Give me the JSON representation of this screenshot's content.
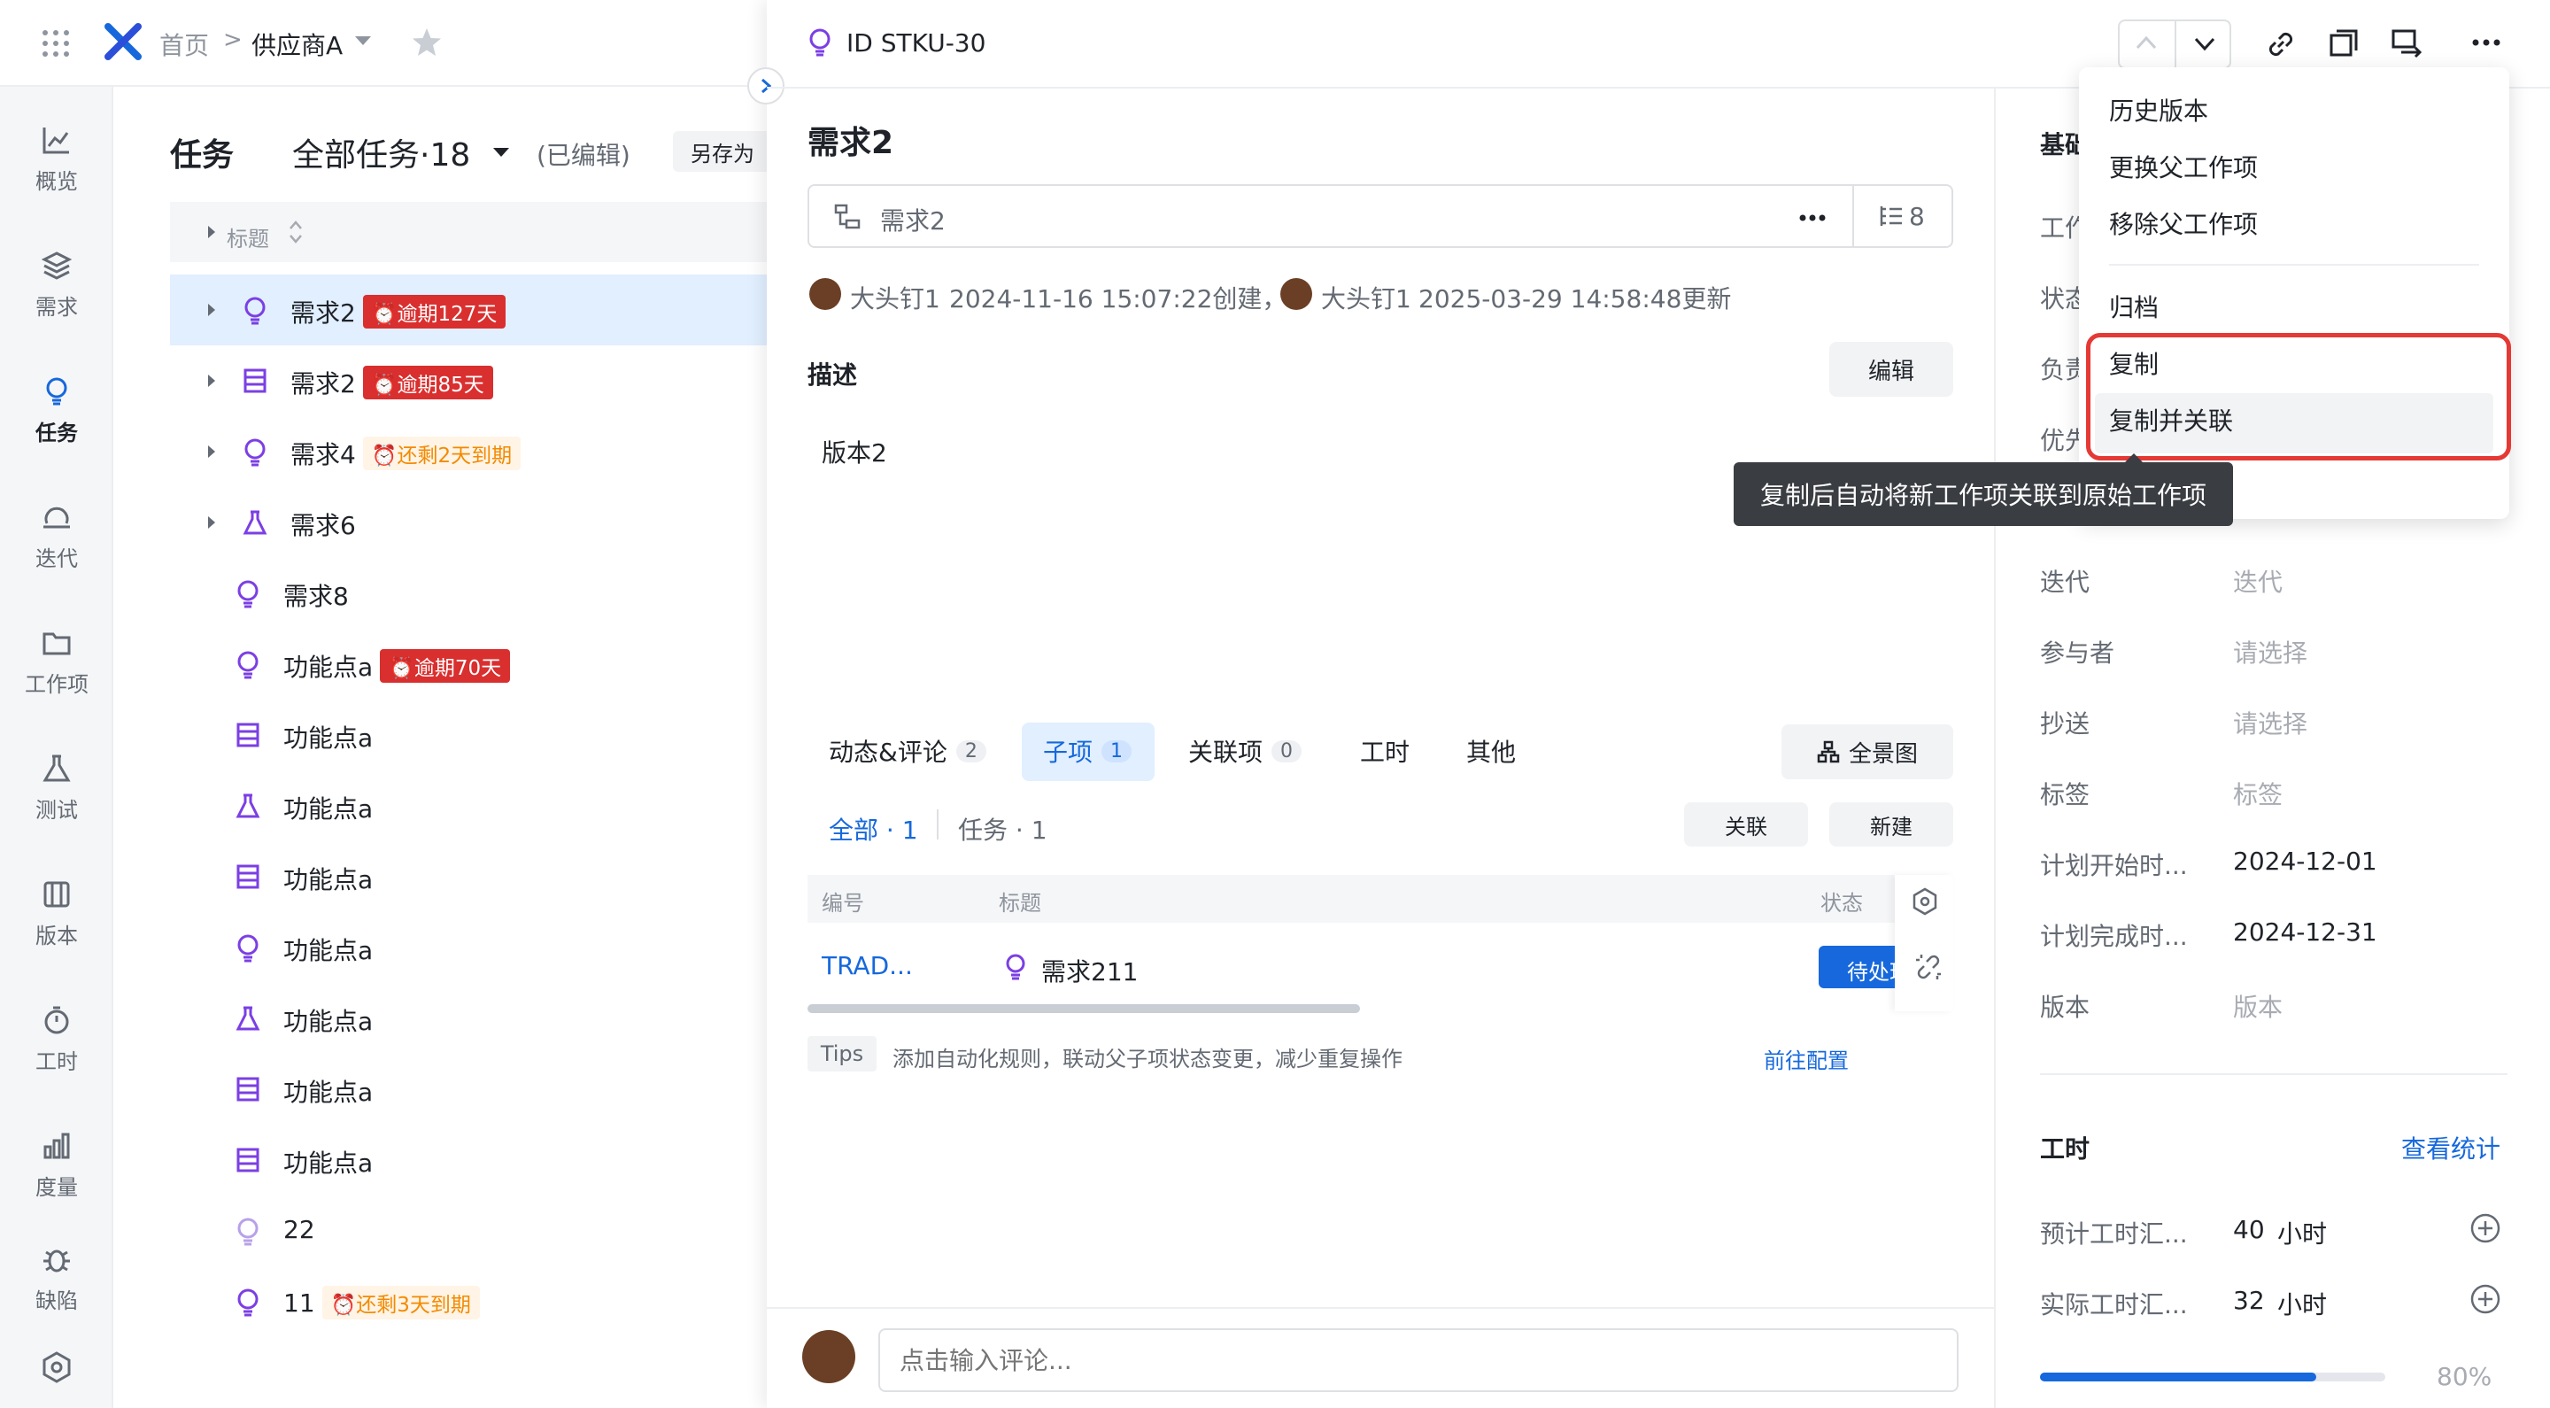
{
  "topbar": {
    "home": "首页",
    "breadcrumb_sep": ">",
    "project": "供应商A"
  },
  "rail": [
    {
      "label": "概览",
      "icon": "chart-line-icon"
    },
    {
      "label": "需求",
      "icon": "layers-icon"
    },
    {
      "label": "任务",
      "icon": "bulb-icon"
    },
    {
      "label": "迭代",
      "icon": "cycle-icon"
    },
    {
      "label": "工作项",
      "icon": "folder-icon"
    },
    {
      "label": "测试",
      "icon": "flask-icon"
    },
    {
      "label": "版本",
      "icon": "book-icon"
    },
    {
      "label": "工时",
      "icon": "stopwatch-icon"
    },
    {
      "label": "度量",
      "icon": "bar-chart-icon"
    },
    {
      "label": "缺陷",
      "icon": "bug-icon"
    }
  ],
  "list": {
    "section_title": "任务",
    "view_name": "全部任务·18",
    "edited": "(已编辑)",
    "save_as": "另存为",
    "column_title": "标题",
    "rows": [
      {
        "title": "需求2",
        "icon": "bulb-icon",
        "badge": "逾期127天",
        "badge_type": "red"
      },
      {
        "title": "需求2",
        "icon": "list-icon",
        "badge": "逾期85天",
        "badge_type": "red"
      },
      {
        "title": "需求4",
        "icon": "bulb-icon",
        "badge": "还剩2天到期",
        "badge_type": "orange"
      },
      {
        "title": "需求6",
        "icon": "flask-icon",
        "badge": "",
        "badge_type": ""
      },
      {
        "title": "需求8",
        "icon": "bulb-icon",
        "badge": "",
        "badge_type": ""
      },
      {
        "title": "功能点a",
        "icon": "bulb-icon",
        "badge": "逾期70天",
        "badge_type": "red"
      },
      {
        "title": "功能点a",
        "icon": "list-icon",
        "badge": "",
        "badge_type": ""
      },
      {
        "title": "功能点a",
        "icon": "flask-icon",
        "badge": "",
        "badge_type": ""
      },
      {
        "title": "功能点a",
        "icon": "list-icon",
        "badge": "",
        "badge_type": ""
      },
      {
        "title": "功能点a",
        "icon": "bulb-icon",
        "badge": "",
        "badge_type": ""
      },
      {
        "title": "功能点a",
        "icon": "flask-icon",
        "badge": "",
        "badge_type": ""
      },
      {
        "title": "功能点a",
        "icon": "list-icon",
        "badge": "",
        "badge_type": ""
      },
      {
        "title": "功能点a",
        "icon": "list-icon",
        "badge": "",
        "badge_type": ""
      },
      {
        "title": "22",
        "icon": "bulb-icon",
        "badge": "",
        "badge_type": ""
      },
      {
        "title": "11",
        "icon": "bulb-icon",
        "badge": "还剩3天到期",
        "badge_type": "orange"
      }
    ]
  },
  "detail": {
    "id": "ID STKU-30",
    "title": "需求2",
    "parent": "需求2",
    "child_count": "8",
    "creator": "大头钉1",
    "created": "2024-11-16 15:07:22创建，",
    "updater": "大头钉1",
    "updated": "2025-03-29 14:58:48更新",
    "desc_label": "描述",
    "edit": "编辑",
    "desc_text": "版本2",
    "tabs": [
      {
        "label": "动态&评论",
        "count": "2"
      },
      {
        "label": "子项",
        "count": "1"
      },
      {
        "label": "关联项",
        "count": "0"
      },
      {
        "label": "工时",
        "count": ""
      },
      {
        "label": "其他",
        "count": ""
      }
    ],
    "overview_btn": "全景图",
    "filter_all": "全部 · 1",
    "filter_task": "任务 · 1",
    "link_btn": "关联",
    "new_btn": "新建",
    "table_head": {
      "id": "编号",
      "title": "标题",
      "status": "状态"
    },
    "table_row": {
      "id": "TRAD...",
      "title": "需求211",
      "status": "待处理"
    },
    "tips_tag": "Tips",
    "tips_text": "添加自动化规则，联动父子项状态变更，减少重复操作",
    "tips_link": "前往配置",
    "comment_placeholder": "点击输入评论..."
  },
  "menu": {
    "items": [
      "历史版本",
      "更换父工作项",
      "移除父工作项",
      "归档",
      "复制",
      "复制并关联"
    ],
    "tooltip": "复制后自动将新工作项关联到原始工作项"
  },
  "fields": {
    "section_basic": "基础",
    "partial": [
      "工作",
      "状态",
      "负责",
      "优先"
    ],
    "rows": [
      {
        "label": "迭代",
        "value": "迭代",
        "placeholder": true
      },
      {
        "label": "参与者",
        "value": "请选择",
        "placeholder": true
      },
      {
        "label": "抄送",
        "value": "请选择",
        "placeholder": true
      },
      {
        "label": "标签",
        "value": "标签",
        "placeholder": true
      },
      {
        "label": "计划开始时...",
        "value": "2024-12-01",
        "placeholder": false
      },
      {
        "label": "计划完成时...",
        "value": "2024-12-31",
        "placeholder": false
      },
      {
        "label": "版本",
        "value": "版本",
        "placeholder": true
      }
    ],
    "worktime_title": "工时",
    "view_stats": "查看统计",
    "estimated_label": "预计工时汇...",
    "estimated_value": "40",
    "actual_label": "实际工时汇...",
    "actual_value": "32",
    "unit": "小时",
    "progress_text": "80%",
    "progress": 0.8
  },
  "colors": {
    "accent": "#1668dc",
    "danger": "#d92f2f",
    "warning": "#f38a00",
    "highlight": "#e53935"
  }
}
